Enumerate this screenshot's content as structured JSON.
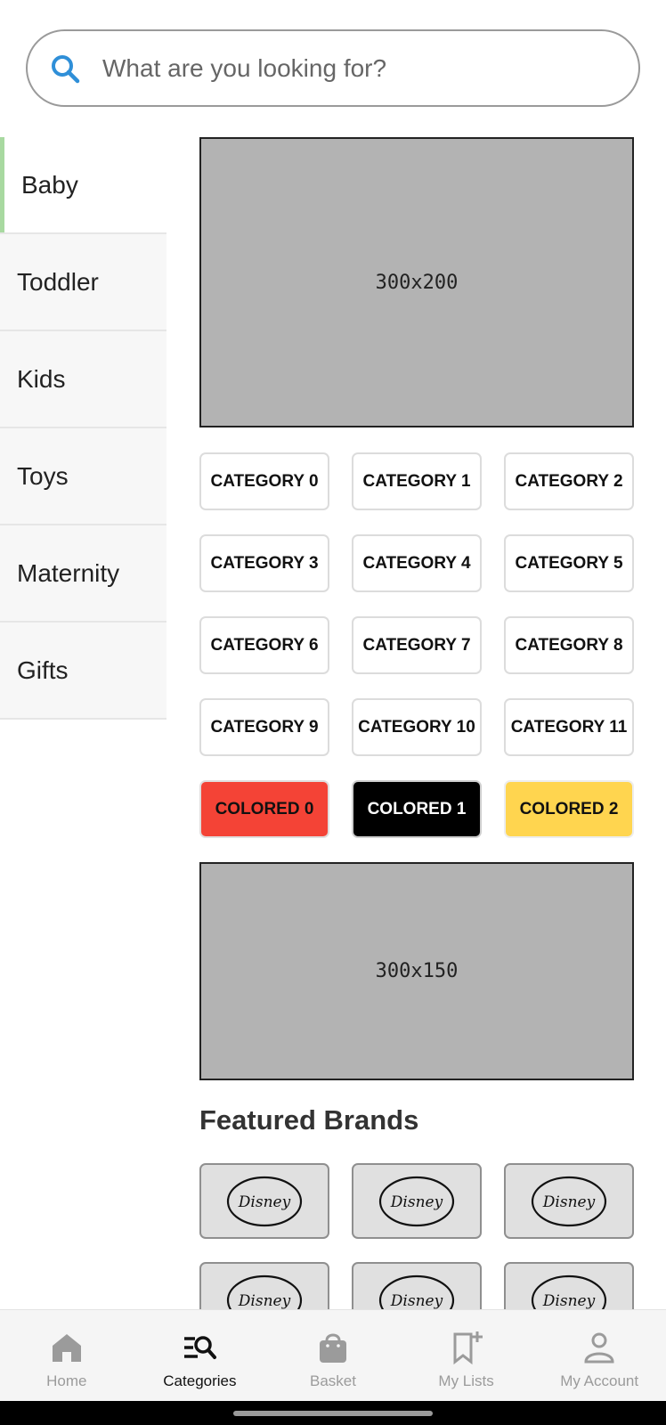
{
  "search": {
    "placeholder": "What are you looking for?"
  },
  "sidebar": {
    "items": [
      {
        "label": "Baby",
        "active": true
      },
      {
        "label": "Toddler"
      },
      {
        "label": "Kids"
      },
      {
        "label": "Toys"
      },
      {
        "label": "Maternity"
      },
      {
        "label": "Gifts"
      }
    ]
  },
  "main": {
    "banner_top": {
      "label": "300x200"
    },
    "categories": [
      "CATEGORY 0",
      "CATEGORY 1",
      "CATEGORY 2",
      "CATEGORY 3",
      "CATEGORY 4",
      "CATEGORY 5",
      "CATEGORY 6",
      "CATEGORY 7",
      "CATEGORY 8",
      "CATEGORY 9",
      "CATEGORY 10",
      "CATEGORY 11"
    ],
    "colored": [
      {
        "label": "COLORED 0",
        "color": "#f44336"
      },
      {
        "label": "COLORED 1",
        "color": "#000000"
      },
      {
        "label": "COLORED 2",
        "color": "#ffd54f"
      }
    ],
    "banner_mid": {
      "label": "300x150"
    },
    "featured_title": "Featured Brands",
    "brands": [
      "Disney",
      "Disney",
      "Disney",
      "Disney",
      "Disney",
      "Disney"
    ]
  },
  "bottom_nav": {
    "items": [
      {
        "label": "Home",
        "icon": "home-icon"
      },
      {
        "label": "Categories",
        "icon": "categories-search-icon",
        "active": true
      },
      {
        "label": "Basket",
        "icon": "shopping-bag-icon"
      },
      {
        "label": "My Lists",
        "icon": "bookmark-add-icon"
      },
      {
        "label": "My Account",
        "icon": "person-icon"
      }
    ]
  },
  "colors": {
    "accent": "#a8d9a0",
    "search_icon": "#2f8fd8",
    "nav_inactive": "#9b9b9b"
  }
}
